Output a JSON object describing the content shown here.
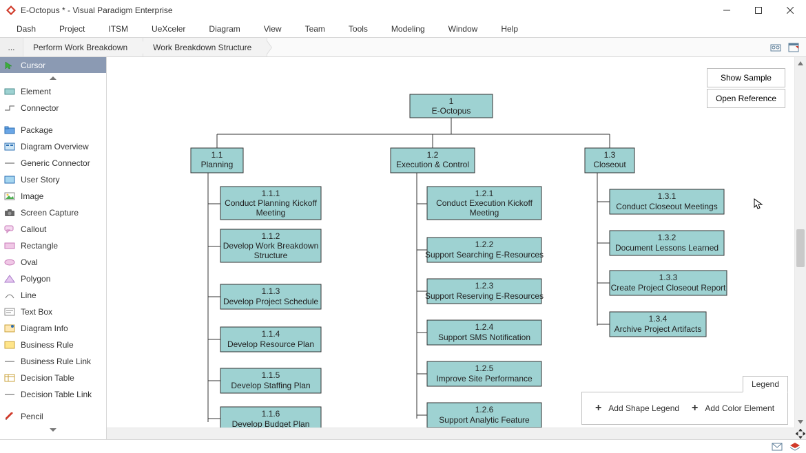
{
  "app": {
    "title": "E-Octopus * - Visual Paradigm Enterprise"
  },
  "menu": [
    "Dash",
    "Project",
    "ITSM",
    "UeXceler",
    "Diagram",
    "View",
    "Team",
    "Tools",
    "Modeling",
    "Window",
    "Help"
  ],
  "breadcrumb": {
    "ellipsis": "...",
    "seg1": "Perform Work Breakdown",
    "seg2": "Work Breakdown Structure"
  },
  "palette": {
    "cursor": "Cursor",
    "element": "Element",
    "connector": "Connector",
    "package": "Package",
    "diagram_overview": "Diagram Overview",
    "generic_connector": "Generic Connector",
    "user_story": "User Story",
    "image": "Image",
    "screen_capture": "Screen Capture",
    "callout": "Callout",
    "rectangle": "Rectangle",
    "oval": "Oval",
    "polygon": "Polygon",
    "line": "Line",
    "text_box": "Text Box",
    "diagram_info": "Diagram Info",
    "business_rule": "Business Rule",
    "business_rule_link": "Business Rule Link",
    "decision_table": "Decision Table",
    "decision_table_link": "Decision Table Link",
    "pencil": "Pencil"
  },
  "floating": {
    "show_sample": "Show Sample",
    "open_reference": "Open Reference"
  },
  "legend": {
    "tab": "Legend",
    "add_shape": "Add Shape Legend",
    "add_color": "Add Color Element"
  },
  "wbs": {
    "root": {
      "id": "1",
      "name": "E-Octopus"
    },
    "c1": {
      "id": "1.1",
      "name": "Planning"
    },
    "c2": {
      "id": "1.2",
      "name": "Execution & Control"
    },
    "c3": {
      "id": "1.3",
      "name": "Closeout"
    },
    "c1_1": {
      "id": "1.1.1",
      "name1": "Conduct Planning Kickoff",
      "name2": "Meeting"
    },
    "c1_2": {
      "id": "1.1.2",
      "name1": "Develop Work Breakdown",
      "name2": "Structure"
    },
    "c1_3": {
      "id": "1.1.3",
      "name": "Develop Project Schedule"
    },
    "c1_4": {
      "id": "1.1.4",
      "name": "Develop Resource Plan"
    },
    "c1_5": {
      "id": "1.1.5",
      "name": "Develop Staffing Plan"
    },
    "c1_6": {
      "id": "1.1.6",
      "name": "Develop Budget Plan"
    },
    "c2_1": {
      "id": "1.2.1",
      "name1": "Conduct Execution Kickoff",
      "name2": "Meeting"
    },
    "c2_2": {
      "id": "1.2.2",
      "name": "Support Searching E-Resources"
    },
    "c2_3": {
      "id": "1.2.3",
      "name": "Support Reserving E-Resources"
    },
    "c2_4": {
      "id": "1.2.4",
      "name": "Support SMS Notification"
    },
    "c2_5": {
      "id": "1.2.5",
      "name": "Improve Site Performance"
    },
    "c2_6": {
      "id": "1.2.6",
      "name": "Support Analytic Feature"
    },
    "c3_1": {
      "id": "1.3.1",
      "name": "Conduct Closeout Meetings"
    },
    "c3_2": {
      "id": "1.3.2",
      "name": "Document Lessons Learned"
    },
    "c3_3": {
      "id": "1.3.3",
      "name": "Create Project Closeout Report"
    },
    "c3_4": {
      "id": "1.3.4",
      "name": "Archive Project Artifacts"
    }
  }
}
